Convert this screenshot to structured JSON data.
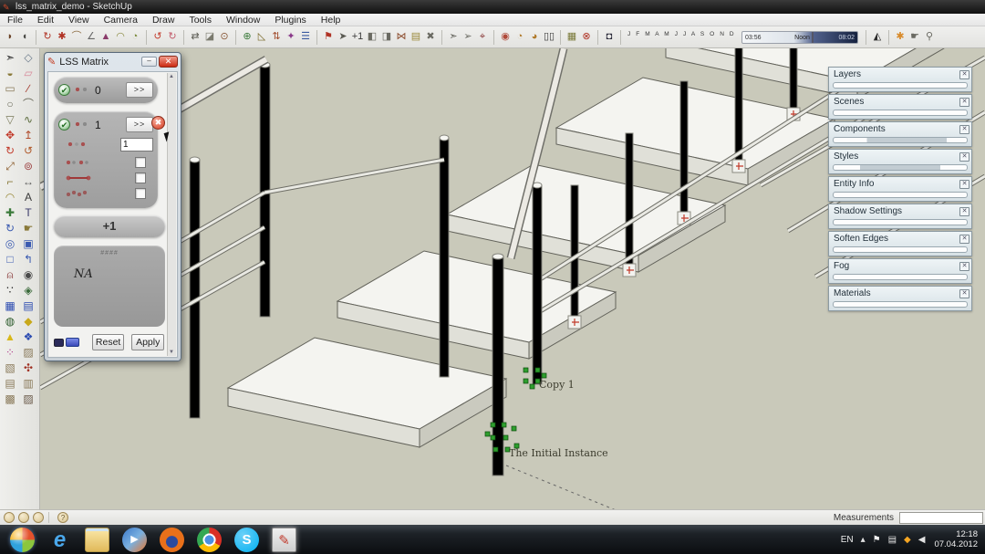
{
  "window": {
    "title": "lss_matrix_demo - SketchUp"
  },
  "menu": {
    "items": [
      "File",
      "Edit",
      "View",
      "Camera",
      "Draw",
      "Tools",
      "Window",
      "Plugins",
      "Help"
    ]
  },
  "top_toolbar": {
    "icons": [
      {
        "name": "smudge",
        "g": "◗",
        "c": "#6a4226"
      },
      {
        "name": "bend-solid",
        "g": "◖",
        "c": "#4a4a46"
      },
      {
        "sep": true
      },
      {
        "name": "rotate-cw",
        "g": "↻",
        "c": "#b03224"
      },
      {
        "name": "gear",
        "g": "✱",
        "c": "#b03224"
      },
      {
        "name": "pie-arc",
        "g": "⌒",
        "c": "#8a6a40"
      },
      {
        "name": "angle",
        "g": "∠",
        "c": "#666"
      },
      {
        "name": "taper",
        "g": "▲",
        "c": "#8a3a6a"
      },
      {
        "name": "dome",
        "g": "◠",
        "c": "#8a8a40"
      },
      {
        "name": "shell",
        "g": "◔",
        "c": "#7a8a3a"
      },
      {
        "sep": true
      },
      {
        "name": "loop-red",
        "g": "↺",
        "c": "#c23a2a"
      },
      {
        "name": "loop-pink",
        "g": "↻",
        "c": "#c25a6a"
      },
      {
        "sep": true
      },
      {
        "name": "shape-bender",
        "g": "⇄",
        "c": "#5a5a52"
      },
      {
        "name": "flatten",
        "g": "◪",
        "c": "#7a7a6e"
      },
      {
        "name": "stamp",
        "g": "⊙",
        "c": "#8a5a3a"
      },
      {
        "sep": true
      },
      {
        "name": "axes-tool",
        "g": "⊕",
        "c": "#3a7a3a"
      },
      {
        "name": "slope",
        "g": "◺",
        "c": "#7a6a2a"
      },
      {
        "name": "swap",
        "g": "⇅",
        "c": "#a04a2a"
      },
      {
        "name": "weld",
        "g": "✦",
        "c": "#8a3a8a"
      },
      {
        "name": "lines",
        "g": "☰",
        "c": "#3a5aa0"
      },
      {
        "sep": true
      },
      {
        "name": "flag",
        "g": "⚑",
        "c": "#b03224"
      },
      {
        "name": "select-plus",
        "g": "➤",
        "c": "#5a5a52"
      },
      {
        "name": "add-point",
        "g": "+1",
        "c": "#3a3a3a"
      },
      {
        "name": "copy-fold",
        "g": "◧",
        "c": "#6a6a62"
      },
      {
        "name": "paste-fold",
        "g": "◨",
        "c": "#6a6a62"
      },
      {
        "name": "mirror",
        "g": "⋈",
        "c": "#8a4a2a"
      },
      {
        "name": "page-new",
        "g": "▤",
        "c": "#9a8a3a"
      },
      {
        "name": "explode",
        "g": "✖",
        "c": "#6a6a62"
      },
      {
        "sep": true
      },
      {
        "name": "cursor-a",
        "g": "➣",
        "c": "#5a5a52"
      },
      {
        "name": "cursor-b",
        "g": "➢",
        "c": "#6a6a62"
      },
      {
        "name": "pin",
        "g": "⌖",
        "c": "#8a3a3a"
      },
      {
        "sep": true
      },
      {
        "name": "orbit-red",
        "g": "◉",
        "c": "#b04a3a"
      },
      {
        "name": "clock-a",
        "g": "◔",
        "c": "#b07a2a"
      },
      {
        "name": "clock-b",
        "g": "◕",
        "c": "#b07a2a"
      },
      {
        "name": "pause",
        "g": "▯▯",
        "c": "#3a3a3a"
      },
      {
        "sep": true
      },
      {
        "name": "layout",
        "g": "▦",
        "c": "#7a7a3a"
      },
      {
        "name": "style-dot",
        "g": "⊗",
        "c": "#b03224"
      },
      {
        "sep": true
      },
      {
        "name": "bucket-dark",
        "g": "◘",
        "c": "#2a2a3a"
      }
    ],
    "months": "J F M A M J J A S O N D",
    "time_start": "03:56",
    "time_noon": "Noon",
    "time_end": "08:02",
    "trailing": [
      {
        "name": "walkboots",
        "g": "◭",
        "c": "#2a2a2a"
      },
      {
        "sep": true
      },
      {
        "name": "orange-hand",
        "g": "✱",
        "c": "#d88a2a"
      },
      {
        "name": "point-hand",
        "g": "☛",
        "c": "#6a6a62"
      },
      {
        "name": "walk-figure",
        "g": "⚲",
        "c": "#6a6a62"
      }
    ]
  },
  "left_toolbar": {
    "icons": [
      {
        "name": "select",
        "g": "➣",
        "c": "#222"
      },
      {
        "name": "make-component",
        "g": "◇",
        "c": "#6a7a8a"
      },
      {
        "name": "paint-bucket",
        "g": "◒",
        "c": "#8a7a3a"
      },
      {
        "name": "eraser",
        "g": "▱",
        "c": "#d88a9a"
      },
      {
        "name": "rectangle",
        "g": "▭",
        "c": "#8a7a5a"
      },
      {
        "name": "line",
        "g": "∕",
        "c": "#a03224"
      },
      {
        "name": "circle",
        "g": "○",
        "c": "#6a6a5a"
      },
      {
        "name": "arc",
        "g": "⌒",
        "c": "#6a6a5a"
      },
      {
        "name": "polygon",
        "g": "▽",
        "c": "#7a7a5a"
      },
      {
        "name": "freehand",
        "g": "∿",
        "c": "#5a6a3a"
      },
      {
        "name": "move",
        "g": "✥",
        "c": "#c23a2a"
      },
      {
        "name": "push-pull",
        "g": "↥",
        "c": "#b04a2a"
      },
      {
        "name": "rotate",
        "g": "↻",
        "c": "#c23a2a"
      },
      {
        "name": "follow-me",
        "g": "↺",
        "c": "#b05a2a"
      },
      {
        "name": "scale",
        "g": "⤢",
        "c": "#8a5a2a"
      },
      {
        "name": "offset",
        "g": "⊚",
        "c": "#a04a4a"
      },
      {
        "name": "tape-measure",
        "g": "⌐",
        "c": "#8a7a3a"
      },
      {
        "name": "dimension",
        "g": "↔",
        "c": "#5a5a5a"
      },
      {
        "name": "protractor",
        "g": "◠",
        "c": "#9a8a3a"
      },
      {
        "name": "text",
        "g": "A",
        "c": "#3a3a3a"
      },
      {
        "name": "axes",
        "g": "✚",
        "c": "#3a7a3a"
      },
      {
        "name": "3d-text",
        "g": "T",
        "c": "#3a3a6a"
      },
      {
        "name": "orbit",
        "g": "↻",
        "c": "#3a5ab0"
      },
      {
        "name": "pan",
        "g": "☛",
        "c": "#8a7a3a"
      },
      {
        "name": "zoom",
        "g": "◎",
        "c": "#3a5ab0"
      },
      {
        "name": "zoom-window",
        "g": "▣",
        "c": "#3a5ab0"
      },
      {
        "name": "zoom-extents",
        "g": "□",
        "c": "#3a5ab0"
      },
      {
        "name": "previous",
        "g": "↰",
        "c": "#3a5ab0"
      },
      {
        "name": "position-camera",
        "g": "⍝",
        "c": "#8a3a3a"
      },
      {
        "name": "look-around",
        "g": "◉",
        "c": "#4a4a4a"
      },
      {
        "name": "walk",
        "g": "∵",
        "c": "#2a2a2a"
      },
      {
        "name": "section-plane",
        "g": "◈",
        "c": "#3a6a3a"
      },
      {
        "name": "lss-grid",
        "g": "▦",
        "c": "#2a4ab0"
      },
      {
        "name": "lss-list",
        "g": "▤",
        "c": "#2a4ab0"
      },
      {
        "name": "lss-map",
        "g": "◍",
        "c": "#2a5a2a"
      },
      {
        "name": "lss-gem",
        "g": "◆",
        "c": "#c8a81a"
      },
      {
        "name": "lss-cone",
        "g": "▲",
        "c": "#d8b81a"
      },
      {
        "name": "lss-blocks",
        "g": "❖",
        "c": "#2a4ab0"
      },
      {
        "name": "lss-dots",
        "g": "⁘",
        "c": "#b03a8a"
      },
      {
        "name": "sandbox-from-contours",
        "g": "▨",
        "c": "#8a7a5a"
      },
      {
        "name": "sandbox-from-scratch",
        "g": "▧",
        "c": "#8a7a5a"
      },
      {
        "name": "smoove",
        "g": "✣",
        "c": "#a03224"
      },
      {
        "name": "stamp-tool",
        "g": "▤",
        "c": "#8a7a5a"
      },
      {
        "name": "drape",
        "g": "▥",
        "c": "#8a7a5a"
      },
      {
        "name": "add-detail",
        "g": "▩",
        "c": "#8a7a5a"
      },
      {
        "name": "flip-edge",
        "g": "▨",
        "c": "#6a5a4a"
      }
    ]
  },
  "dialog": {
    "title": "LSS Matrix",
    "controls": {
      "min": "‒",
      "close": "✕"
    },
    "row0": {
      "check": "✔",
      "value": "0",
      "more": ">>"
    },
    "row1": {
      "check": "✔",
      "value": "1",
      "more": ">>",
      "close": "✖"
    },
    "input_value": "1",
    "add_label": "+1",
    "na_header": "####",
    "na_label": "NA",
    "reset_label": "Reset",
    "apply_label": "Apply"
  },
  "trays": {
    "items": [
      {
        "label": "Layers"
      },
      {
        "label": "Scenes"
      },
      {
        "label": "Components"
      },
      {
        "label": "Styles"
      },
      {
        "label": "Entity Info"
      },
      {
        "label": "Shadow Settings"
      },
      {
        "label": "Soften Edges"
      },
      {
        "label": "Fog"
      },
      {
        "label": "Materials"
      }
    ],
    "detach_glyph": "✕"
  },
  "viewport": {
    "copy_label": "Copy 1",
    "initial_label": "The Initial Instance"
  },
  "statusbar": {
    "measurements_label": "Measurements",
    "help": "?"
  },
  "taskbar": {
    "lang": "EN",
    "time": "12:18",
    "date": "07.04.2012",
    "apps": [
      {
        "name": "start"
      },
      {
        "name": "internet-explorer",
        "g": "e"
      },
      {
        "name": "explorer"
      },
      {
        "name": "media-player",
        "g": "▶"
      },
      {
        "name": "firefox"
      },
      {
        "name": "chrome"
      },
      {
        "name": "skype",
        "g": "S"
      },
      {
        "name": "sketchup",
        "g": "✎"
      }
    ],
    "tray": [
      {
        "name": "hidden-icons",
        "g": "▴"
      },
      {
        "name": "action-center",
        "g": "⚑"
      },
      {
        "name": "network",
        "g": "▤"
      },
      {
        "name": "update",
        "g": "◆"
      },
      {
        "name": "volume",
        "g": "◀"
      }
    ]
  }
}
